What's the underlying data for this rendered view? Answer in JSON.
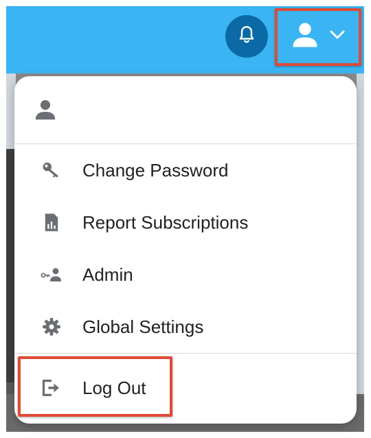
{
  "colors": {
    "topbar": "#3ab4f2",
    "bell_button": "#0b6aa5",
    "highlight": "#e04a36",
    "icon_gray": "#6b6f73",
    "text": "#202124"
  },
  "header": {
    "bell_icon": "bell-icon",
    "user_icon": "person-icon",
    "dropdown_icon": "chevron-down-icon"
  },
  "menu": {
    "header_icon": "person-icon",
    "items": [
      {
        "label": "Change Password",
        "icon": "key-icon"
      },
      {
        "label": "Report Subscriptions",
        "icon": "report-icon"
      },
      {
        "label": "Admin",
        "icon": "admin-icon"
      },
      {
        "label": "Global Settings",
        "icon": "gear-icon"
      }
    ],
    "logout": {
      "label": "Log Out",
      "icon": "logout-icon"
    }
  }
}
